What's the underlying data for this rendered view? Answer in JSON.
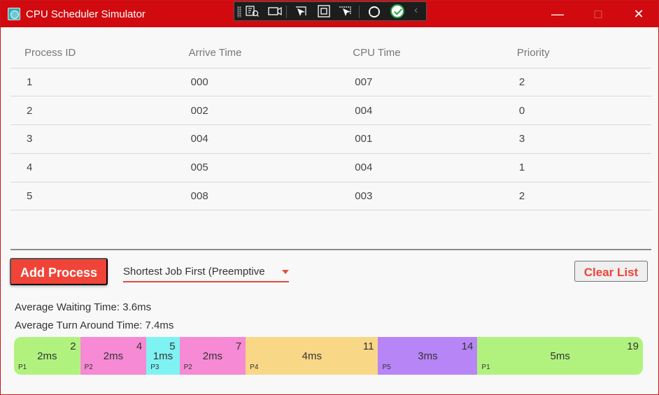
{
  "window": {
    "title": "CPU Scheduler Simulator",
    "controls": {
      "minimize": "—",
      "maximize": "□",
      "close": "✕"
    }
  },
  "table": {
    "headers": [
      "Process ID",
      "Arrive Time",
      "CPU Time",
      "Priority"
    ],
    "rows": [
      [
        "1",
        "000",
        "007",
        "2"
      ],
      [
        "2",
        "002",
        "004",
        "0"
      ],
      [
        "3",
        "004",
        "001",
        "3"
      ],
      [
        "4",
        "005",
        "004",
        "1"
      ],
      [
        "5",
        "008",
        "003",
        "2"
      ]
    ]
  },
  "controls": {
    "add_process": "Add Process",
    "algorithm_selected": "Shortest Job First (Preemptive",
    "clear_list": "Clear List"
  },
  "stats": {
    "average_waiting": "Average Waiting Time: 3.6ms",
    "average_turnaround": "Average Turn Around Time: 7.4ms"
  },
  "gantt": {
    "total_time": 19,
    "blocks": [
      {
        "process": "P1",
        "duration_label": "2ms",
        "start": 0,
        "end": 2,
        "end_label": "2",
        "color": "#b1f27f"
      },
      {
        "process": "P2",
        "duration_label": "2ms",
        "start": 2,
        "end": 4,
        "end_label": "4",
        "color": "#f68ad4"
      },
      {
        "process": "P3",
        "duration_label": "1ms",
        "start": 4,
        "end": 5,
        "end_label": "5",
        "color": "#7ff2f3"
      },
      {
        "process": "P2",
        "duration_label": "2ms",
        "start": 5,
        "end": 7,
        "end_label": "7",
        "color": "#f68ad4"
      },
      {
        "process": "P4",
        "duration_label": "4ms",
        "start": 7,
        "end": 11,
        "end_label": "11",
        "color": "#f8d786"
      },
      {
        "process": "P5",
        "duration_label": "3ms",
        "start": 11,
        "end": 14,
        "end_label": "14",
        "color": "#b785f6"
      },
      {
        "process": "P1",
        "duration_label": "5ms",
        "start": 14,
        "end": 19,
        "end_label": "19",
        "color": "#b1f27f"
      }
    ]
  },
  "icons": {
    "app": "cpu-scheduler-app-icon",
    "inspect": "inspect-element-icon",
    "record": "camera-record-icon",
    "select": "select-element-icon",
    "layout": "layout-bounds-icon",
    "adorner": "adorner-icon",
    "hot_reload": "hot-reload-icon",
    "binding": "binding-check-icon",
    "collapse": "collapse-toolbar-icon"
  }
}
